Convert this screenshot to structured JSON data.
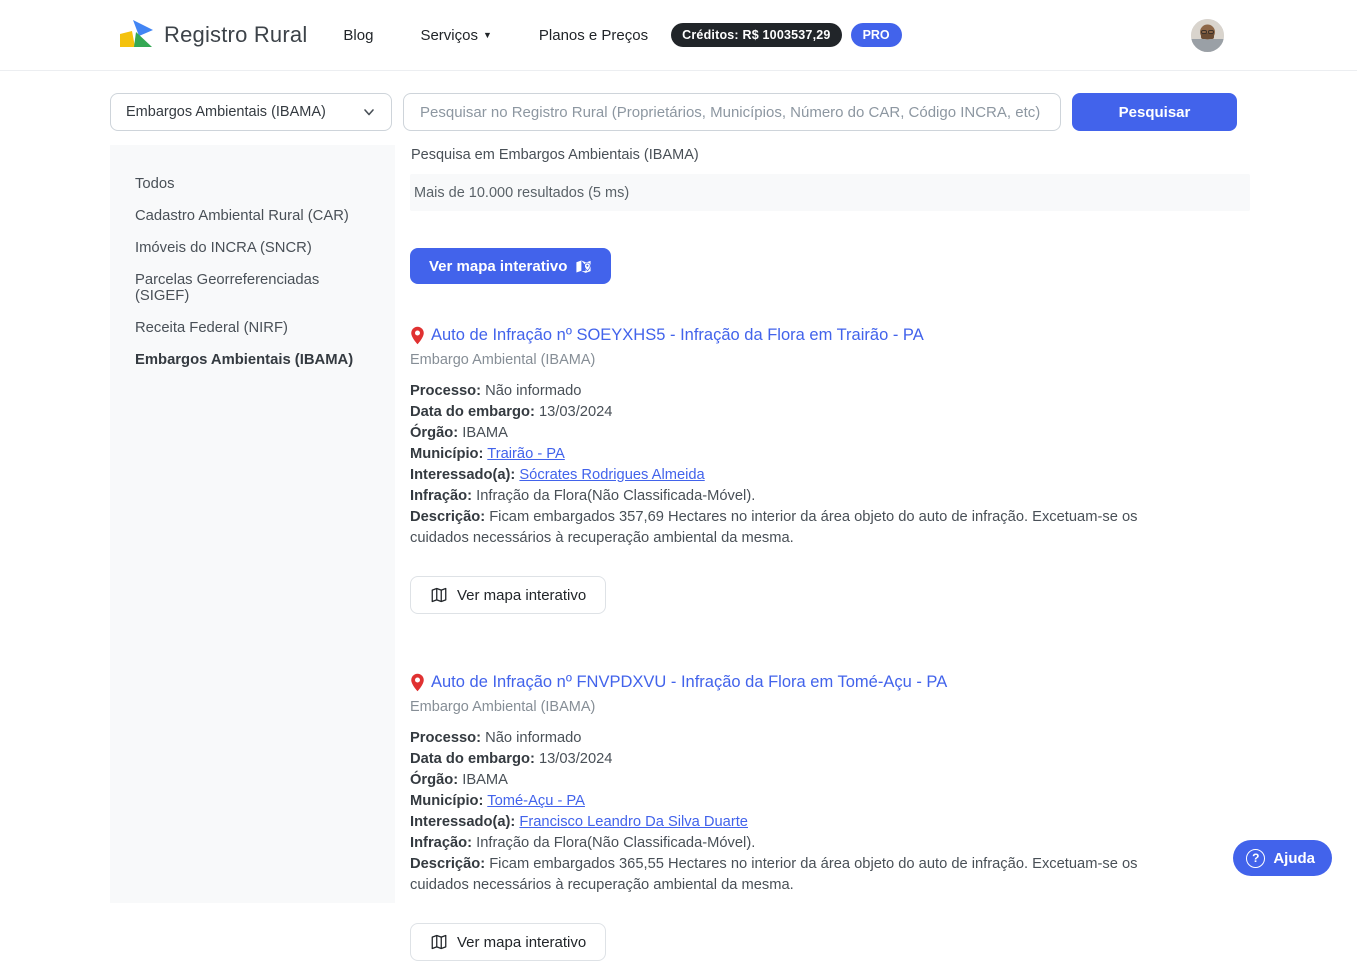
{
  "header": {
    "brand": "Registro Rural",
    "nav_blog": "Blog",
    "nav_servicos": "Serviços",
    "nav_planos": "Planos e Preços",
    "credits": "Créditos: R$ 1003537,29",
    "pro": "PRO"
  },
  "search": {
    "category": "Embargos Ambientais (IBAMA)",
    "placeholder": "Pesquisar no Registro Rural (Proprietários, Municípios, Número do CAR, Código INCRA, etc)",
    "submit": "Pesquisar"
  },
  "sidebar": {
    "items": [
      {
        "label": "Todos"
      },
      {
        "label": "Cadastro Ambiental Rural (CAR)"
      },
      {
        "label": "Imóveis do INCRA (SNCR)"
      },
      {
        "label": "Parcelas Georreferenciadas (SIGEF)"
      },
      {
        "label": "Receita Federal (NIRF)"
      },
      {
        "label": "Embargos Ambientais (IBAMA)"
      }
    ],
    "active_index": 5
  },
  "results": {
    "context": "Pesquisa em Embargos Ambientais (IBAMA)",
    "count": "Mais de 10.000 resultados (5 ms)",
    "map_button": "Ver mapa interativo",
    "field_labels": {
      "processo": "Processo:",
      "data_embargo": "Data do embargo:",
      "orgao": "Órgão:",
      "municipio": "Município:",
      "interessado": "Interessado(a):",
      "infracao": "Infração:",
      "descricao": "Descrição:"
    },
    "items": [
      {
        "title": "Auto de Infração nº SOEYXHS5 - Infração da Flora em Trairão - PA",
        "type": "Embargo Ambiental (IBAMA)",
        "processo": "Não informado",
        "data_embargo": "13/03/2024",
        "orgao": "IBAMA",
        "municipio": "Trairão - PA",
        "interessado": "Sócrates Rodrigues Almeida",
        "infracao": "Infração da Flora(Não Classificada-Móvel).",
        "descricao": "Ficam embargados 357,69 Hectares no interior da área objeto do auto de infração. Excetuam-se os cuidados necessários à recuperação ambiental da mesma.",
        "map_button": "Ver mapa interativo"
      },
      {
        "title": "Auto de Infração nº FNVPDXVU - Infração da Flora em Tomé-Açu - PA",
        "type": "Embargo Ambiental (IBAMA)",
        "processo": "Não informado",
        "data_embargo": "13/03/2024",
        "orgao": "IBAMA",
        "municipio": "Tomé-Açu - PA",
        "interessado": "Francisco Leandro Da Silva Duarte",
        "infracao": "Infração da Flora(Não Classificada-Móvel).",
        "descricao": "Ficam embargados 365,55 Hectares no interior da área objeto do auto de infração. Excetuam-se os cuidados necessários à recuperação ambiental da mesma.",
        "map_button": "Ver mapa interativo"
      }
    ]
  },
  "help": {
    "label": "Ajuda"
  },
  "colors": {
    "accent": "#4263eb",
    "pin_red": "#e03131",
    "badge_dark": "#212529",
    "panel": "#f8f9fa"
  }
}
